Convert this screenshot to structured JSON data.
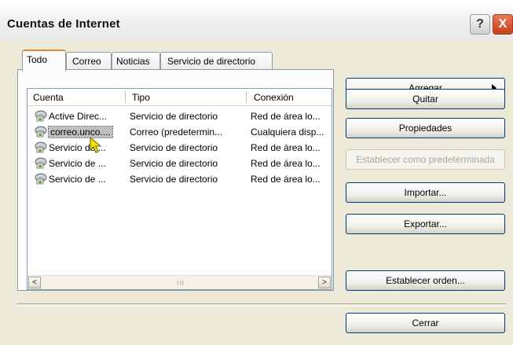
{
  "window": {
    "title": "Cuentas de Internet"
  },
  "titlebar_buttons": {
    "help": "?",
    "close": "X"
  },
  "tabs": [
    {
      "label": "Todo",
      "active": true
    },
    {
      "label": "Correo",
      "active": false
    },
    {
      "label": "Noticias",
      "active": false
    },
    {
      "label": "Servicio de directorio",
      "active": false
    }
  ],
  "list": {
    "columns": [
      "Cuenta",
      "Tipo",
      "Conexión"
    ],
    "rows": [
      {
        "cuenta": "Active Direc...",
        "tipo": "Servicio de directorio",
        "conexion": "Red de área lo..."
      },
      {
        "cuenta": "correo.unco....",
        "tipo": "Correo (predetermin...",
        "conexion": "Cualquiera disp...",
        "selected": true
      },
      {
        "cuenta": "Servicio de ...",
        "tipo": "Servicio de directorio",
        "conexion": "Red de área lo..."
      },
      {
        "cuenta": "Servicio de ...",
        "tipo": "Servicio de directorio",
        "conexion": "Red de área lo..."
      },
      {
        "cuenta": "Servicio de ...",
        "tipo": "Servicio de directorio",
        "conexion": "Red de área lo..."
      }
    ],
    "scroll_left": "<",
    "scroll_right": ">",
    "scroll_grip": "III"
  },
  "buttons": {
    "agregar": "Agregar",
    "quitar": "Quitar",
    "propiedades": "Propiedades",
    "establecer_predeterminada": "Establecer como predeterminada",
    "importar": "Importar...",
    "exportar": "Exportar...",
    "establecer_orden": "Establecer orden...",
    "cerrar": "Cerrar"
  },
  "colors": {
    "selection": "#c0c0c0",
    "tab_highlight": "#e68b2c",
    "button_border": "#003c74",
    "close_button": "#c8401c"
  }
}
